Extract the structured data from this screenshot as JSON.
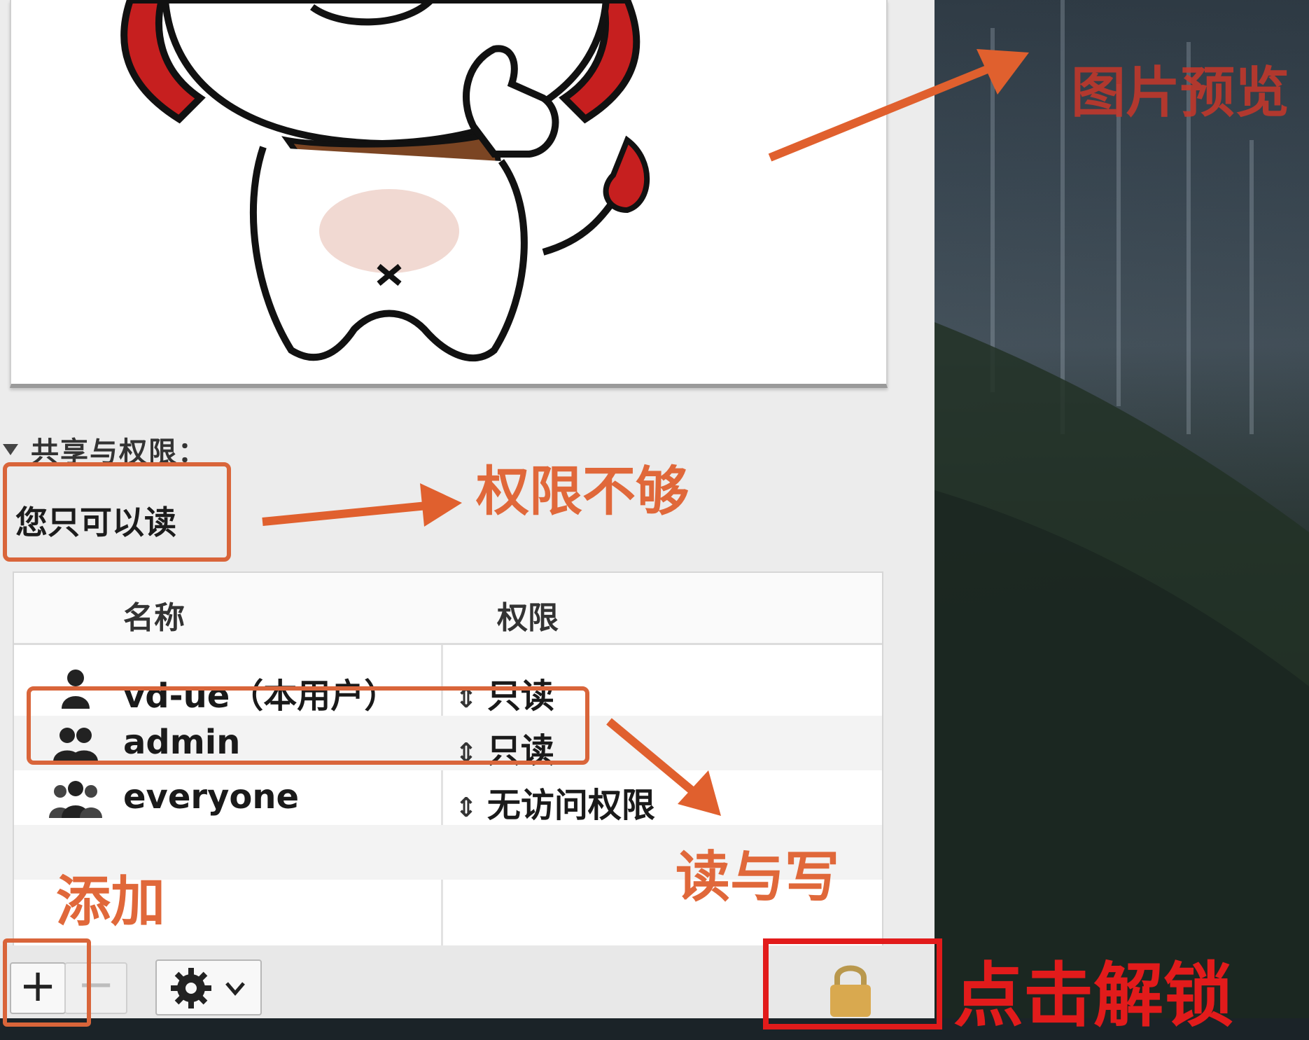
{
  "section": {
    "title": "共享与权限："
  },
  "permission_note": "您只可以读",
  "table": {
    "headers": {
      "name": "名称",
      "privilege": "权限"
    },
    "rows": [
      {
        "name": "vd-ue（本用户）",
        "privilege": "只读",
        "icon": "single-user-icon"
      },
      {
        "name": "admin",
        "privilege": "只读",
        "icon": "group-users-icon"
      },
      {
        "name": "everyone",
        "privilege": "无访问权限",
        "icon": "everyone-icon"
      }
    ]
  },
  "toolbar": {
    "add_label": "+",
    "remove_label": "−",
    "action_icon": "gear-icon",
    "lock_icon": "lock-icon"
  },
  "annotations": {
    "preview": "图片预览",
    "insufficient": "权限不够",
    "read_write": "读与写",
    "add": "添加",
    "unlock": "点击解锁"
  },
  "colors": {
    "annotation_orange": "#e0683a",
    "annotation_red": "#e21b1b",
    "panel_bg": "#ececec"
  }
}
